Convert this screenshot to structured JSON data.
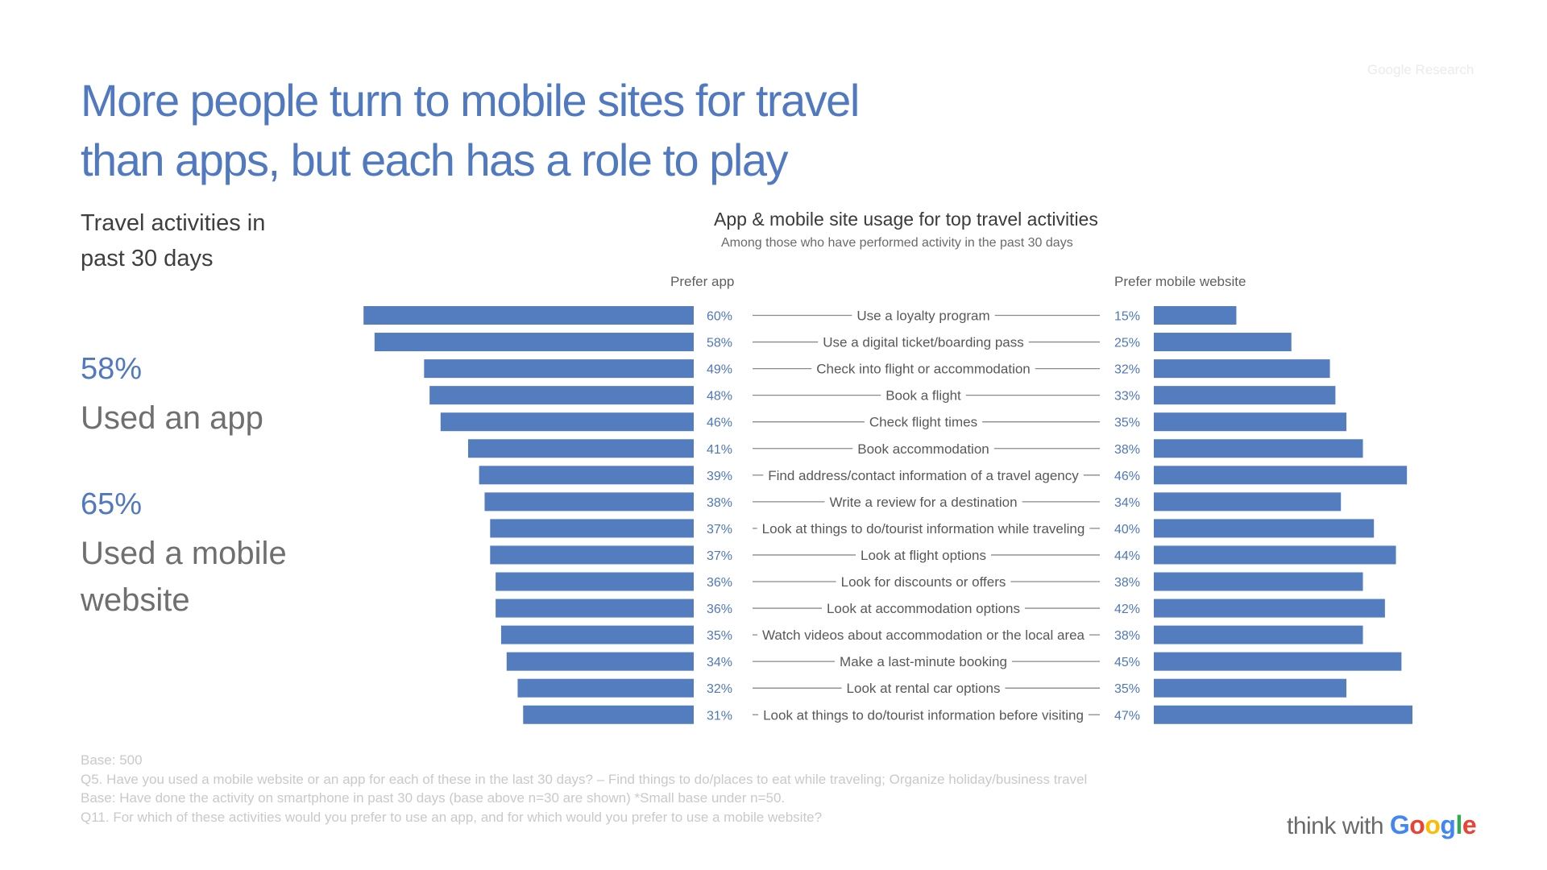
{
  "page": {
    "title_line1": "More people turn to mobile sites for travel",
    "title_line2": "than apps, but each has a role to play",
    "watermark": "Google Research"
  },
  "left_panel": {
    "subtitle_line1": "Travel activities in",
    "subtitle_line2": "past 30 days",
    "stats": [
      {
        "value": "58%",
        "label_line1": "Used an app",
        "label_line2": ""
      },
      {
        "value": "65%",
        "label_line1": "Used a mobile",
        "label_line2": "website"
      }
    ]
  },
  "footnotes": [
    "Base: 500",
    "Q5. Have you used a mobile website or an app for each of these in the last 30 days? – Find things to do/places to eat while traveling; Organize holiday/business travel",
    "Base: Have done the activity on smartphone in past 30 days (base above n=30 are shown) *Small base under n=50.",
    "Q11. For which of these activities would you prefer to use an app, and for which would you prefer to use a mobile website?"
  ],
  "logo": {
    "prefix": "think with",
    "letters": [
      {
        "ch": "G",
        "color": "#4285f4"
      },
      {
        "ch": "o",
        "color": "#ea4335"
      },
      {
        "ch": "o",
        "color": "#fbbc05"
      },
      {
        "ch": "g",
        "color": "#4285f4"
      },
      {
        "ch": "l",
        "color": "#34a853"
      },
      {
        "ch": "e",
        "color": "#ea4335"
      }
    ]
  },
  "colors": {
    "bar": "#537dbf",
    "accent": "#5079bf"
  },
  "chart_data": {
    "type": "bar",
    "orientation": "horizontal-diverging",
    "title": "App & mobile site usage for top travel activities",
    "subtitle": "Among those who have performed activity in the past 30 days",
    "unit": "%",
    "series": [
      {
        "name": "Prefer app",
        "side": "left",
        "values": [
          60,
          58,
          49,
          48,
          46,
          41,
          39,
          38,
          37,
          37,
          36,
          36,
          35,
          34,
          32,
          31
        ]
      },
      {
        "name": "Prefer mobile website",
        "side": "right",
        "values": [
          15,
          25,
          32,
          33,
          35,
          38,
          46,
          34,
          40,
          44,
          38,
          42,
          38,
          45,
          35,
          47
        ]
      }
    ],
    "categories": [
      "Use a loyalty program",
      "Use a digital ticket/boarding pass",
      "Check into flight or accommodation",
      "Book a flight",
      "Check flight times",
      "Book accommodation",
      "Find address/contact information of a travel agency",
      "Write a review for a destination",
      "Look at things to do/tourist information while traveling",
      "Look at flight options",
      "Look for discounts or offers",
      "Look at accommodation options",
      "Watch videos about accommodation or the local area",
      "Make a last-minute booking",
      "Look at rental car options",
      "Look at things to do/tourist information before visiting"
    ],
    "xlim": [
      0,
      60
    ]
  }
}
